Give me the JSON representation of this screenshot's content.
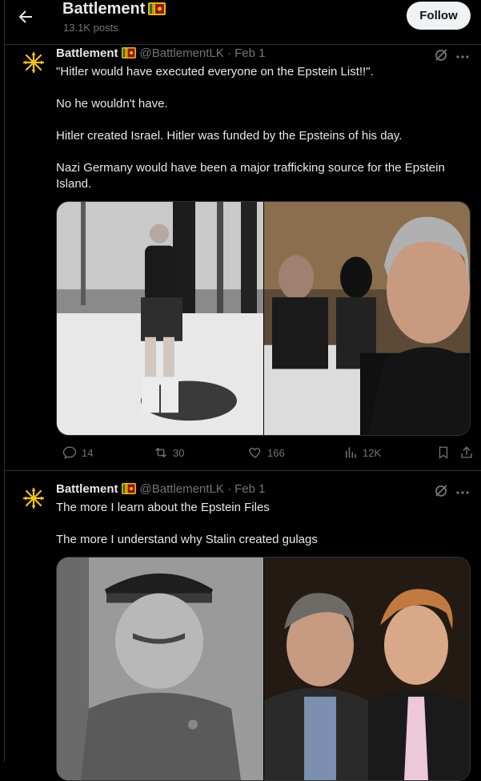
{
  "header": {
    "title": "Battlement",
    "post_count": "13.1K posts",
    "follow_label": "Follow"
  },
  "tweets": [
    {
      "name": "Battlement",
      "handle": "@BattlementLK",
      "date": "· Feb 1",
      "paragraphs": [
        "\"Hitler would have executed everyone on the Epstein List!!\".",
        "No he wouldn't have.",
        "Hitler created Israel. Hitler was funded by the Epsteins of his day.",
        "Nazi Germany would have been a major trafficking source for the Epstein Island."
      ],
      "stats": {
        "replies": "14",
        "reposts": "30",
        "likes": "166",
        "views": "12K"
      }
    },
    {
      "name": "Battlement",
      "handle": "@BattlementLK",
      "date": "· Feb 1",
      "paragraphs": [
        "The more I learn about the Epstein Files",
        "The more I understand why Stalin created gulags"
      ]
    }
  ],
  "icons": {
    "back": "arrow-left-icon",
    "flag": "sri-lanka-flag-icon",
    "grok": "grok-icon",
    "more": "more-icon",
    "reply": "reply-icon",
    "repost": "repost-icon",
    "like": "like-icon",
    "views": "views-icon",
    "bookmark": "bookmark-icon",
    "share": "share-icon"
  },
  "colors": {
    "background": "#000000",
    "text": "#e7e9ea",
    "muted": "#71767b",
    "border": "#2f3336",
    "avatar": "#f2c21b",
    "follow_bg": "#eff3f4"
  }
}
